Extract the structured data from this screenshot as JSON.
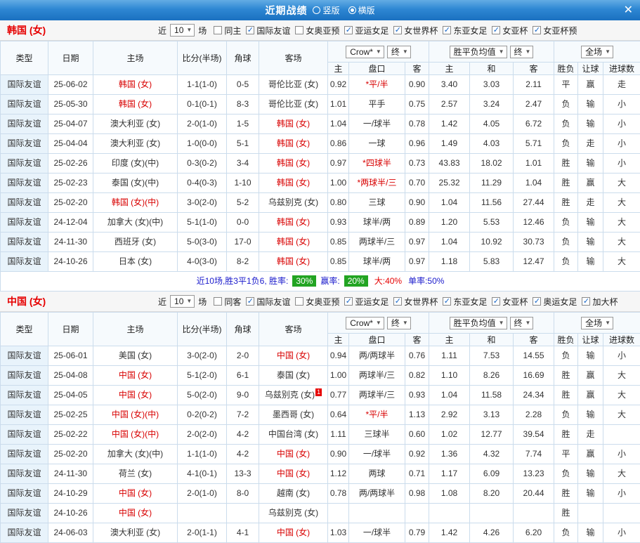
{
  "header": {
    "title": "近期战绩",
    "vertical_label": "竖版",
    "horizontal_label": "横版",
    "selected_layout": "横版",
    "close_glyph": "✕"
  },
  "colors": {
    "topbar_blue": "#1a70c0",
    "result_red": "#e60000",
    "result_green": "#009000",
    "result_blue": "#1a1acc",
    "team_red": "#d80000",
    "type_blue": "#0b50c0",
    "score_red": "#c02800",
    "badge_green": "#22a422",
    "grid_border": "#cbdcec"
  },
  "filter_labels": {
    "near": "近",
    "count": "10",
    "games": "场"
  },
  "table_headers": {
    "main": [
      "类型",
      "日期",
      "主场",
      "比分(半场)",
      "角球",
      "客场"
    ],
    "sub": [
      "主",
      "盘口",
      "客",
      "主",
      "和",
      "客",
      "胜负",
      "让球",
      "进球数"
    ],
    "odds_group_selects": [
      "Crow*",
      "终"
    ],
    "europe_group_selects": [
      "胜平负均值",
      "终"
    ],
    "result_group_selects": [
      "全场"
    ]
  },
  "sections": [
    {
      "title": "韩国 (女)",
      "filter_checkboxes": [
        {
          "label": "同主",
          "checked": false
        },
        {
          "label": "国际友谊",
          "checked": true
        },
        {
          "label": "女奥亚预",
          "checked": false
        },
        {
          "label": "亚运女足",
          "checked": true
        },
        {
          "label": "女世界杯",
          "checked": true
        },
        {
          "label": "东亚女足",
          "checked": true
        },
        {
          "label": "女亚杯",
          "checked": true
        },
        {
          "label": "女亚杯预",
          "checked": true
        }
      ],
      "rows": [
        {
          "type": "国际友谊",
          "date": "25-06-02",
          "home": "韩国 (女)",
          "home_red": true,
          "score": "1-1(1-0)",
          "corner": "0-5",
          "away": "哥伦比亚 (女)",
          "away_red": false,
          "h": "0.92",
          "hcap": "*平/半",
          "a": "0.90",
          "ew": "3.40",
          "ed": "3.03",
          "el": "2.11",
          "r1": "平",
          "r2": "赢",
          "r3": "走"
        },
        {
          "type": "国际友谊",
          "date": "25-05-30",
          "home": "韩国 (女)",
          "home_red": true,
          "score": "0-1(0-1)",
          "corner": "8-3",
          "away": "哥伦比亚 (女)",
          "away_red": false,
          "h": "1.01",
          "hcap": "平手",
          "a": "0.75",
          "ew": "2.57",
          "ed": "3.24",
          "el": "2.47",
          "r1": "负",
          "r2": "输",
          "r3": "小"
        },
        {
          "type": "国际友谊",
          "date": "25-04-07",
          "home": "澳大利亚 (女)",
          "home_red": false,
          "score": "2-0(1-0)",
          "corner": "1-5",
          "away": "韩国 (女)",
          "away_red": true,
          "h": "1.04",
          "hcap": "一/球半",
          "a": "0.78",
          "ew": "1.42",
          "ed": "4.05",
          "el": "6.72",
          "r1": "负",
          "r2": "输",
          "r3": "小"
        },
        {
          "type": "国际友谊",
          "date": "25-04-04",
          "home": "澳大利亚 (女)",
          "home_red": false,
          "score": "1-0(0-0)",
          "corner": "5-1",
          "away": "韩国 (女)",
          "away_red": true,
          "h": "0.86",
          "hcap": "一球",
          "a": "0.96",
          "ew": "1.49",
          "ed": "4.03",
          "el": "5.71",
          "r1": "负",
          "r2": "走",
          "r3": "小"
        },
        {
          "type": "国际友谊",
          "date": "25-02-26",
          "home": "印度 (女)(中)",
          "home_red": false,
          "score": "0-3(0-2)",
          "corner": "3-4",
          "away": "韩国 (女)",
          "away_red": true,
          "h": "0.97",
          "hcap": "*四球半",
          "a": "0.73",
          "ew": "43.83",
          "ed": "18.02",
          "el": "1.01",
          "r1": "胜",
          "r2": "输",
          "r3": "小"
        },
        {
          "type": "国际友谊",
          "date": "25-02-23",
          "home": "泰国 (女)(中)",
          "home_red": false,
          "score": "0-4(0-3)",
          "corner": "1-10",
          "away": "韩国 (女)",
          "away_red": true,
          "h": "1.00",
          "hcap": "*两球半/三",
          "a": "0.70",
          "ew": "25.32",
          "ed": "11.29",
          "el": "1.04",
          "r1": "胜",
          "r2": "赢",
          "r3": "大"
        },
        {
          "type": "国际友谊",
          "date": "25-02-20",
          "home": "韩国 (女)(中)",
          "home_red": true,
          "score": "3-0(2-0)",
          "corner": "5-2",
          "away": "乌兹别克 (女)",
          "away_red": false,
          "h": "0.80",
          "hcap": "三球",
          "a": "0.90",
          "ew": "1.04",
          "ed": "11.56",
          "el": "27.44",
          "r1": "胜",
          "r2": "走",
          "r3": "大"
        },
        {
          "type": "国际友谊",
          "date": "24-12-04",
          "home": "加拿大 (女)(中)",
          "home_red": false,
          "score": "5-1(1-0)",
          "corner": "0-0",
          "away": "韩国 (女)",
          "away_red": true,
          "h": "0.93",
          "hcap": "球半/两",
          "a": "0.89",
          "ew": "1.20",
          "ed": "5.53",
          "el": "12.46",
          "r1": "负",
          "r2": "输",
          "r3": "大"
        },
        {
          "type": "国际友谊",
          "date": "24-11-30",
          "home": "西班牙 (女)",
          "home_red": false,
          "score": "5-0(3-0)",
          "corner": "17-0",
          "away": "韩国 (女)",
          "away_red": true,
          "h": "0.85",
          "hcap": "两球半/三",
          "a": "0.97",
          "ew": "1.04",
          "ed": "10.92",
          "el": "30.73",
          "r1": "负",
          "r2": "输",
          "r3": "大"
        },
        {
          "type": "国际友谊",
          "date": "24-10-26",
          "home": "日本 (女)",
          "home_red": false,
          "score": "4-0(3-0)",
          "corner": "8-2",
          "away": "韩国 (女)",
          "away_red": true,
          "h": "0.85",
          "hcap": "球半/两",
          "a": "0.97",
          "ew": "1.18",
          "ed": "5.83",
          "el": "12.47",
          "r1": "负",
          "r2": "输",
          "r3": "大"
        }
      ],
      "summary": {
        "prefix": "近10场,胜3平1负6, 胜率:",
        "win_rate": "30%",
        "odds_label": "赢率:",
        "odds_rate": "20%",
        "big": "大:40%",
        "single": "单率:50%"
      }
    },
    {
      "title": "中国 (女)",
      "filter_checkboxes": [
        {
          "label": "同客",
          "checked": false
        },
        {
          "label": "国际友谊",
          "checked": true
        },
        {
          "label": "女奥亚预",
          "checked": false
        },
        {
          "label": "亚运女足",
          "checked": true
        },
        {
          "label": "女世界杯",
          "checked": true
        },
        {
          "label": "东亚女足",
          "checked": true
        },
        {
          "label": "女亚杯",
          "checked": true
        },
        {
          "label": "奥运女足",
          "checked": true
        },
        {
          "label": "加大杯",
          "checked": true
        }
      ],
      "rows": [
        {
          "type": "国际友谊",
          "date": "25-06-01",
          "home": "美国 (女)",
          "home_red": false,
          "score": "3-0(2-0)",
          "corner": "2-0",
          "away": "中国 (女)",
          "away_red": true,
          "h": "0.94",
          "hcap": "两/两球半",
          "a": "0.76",
          "ew": "1.11",
          "ed": "7.53",
          "el": "14.55",
          "r1": "负",
          "r2": "输",
          "r3": "小"
        },
        {
          "type": "国际友谊",
          "date": "25-04-08",
          "home": "中国 (女)",
          "home_red": true,
          "score": "5-1(2-0)",
          "corner": "6-1",
          "away": "泰国 (女)",
          "away_red": false,
          "h": "1.00",
          "hcap": "两球半/三",
          "a": "0.82",
          "ew": "1.10",
          "ed": "8.26",
          "el": "16.69",
          "r1": "胜",
          "r2": "赢",
          "r3": "大"
        },
        {
          "type": "国际友谊",
          "date": "25-04-05",
          "home": "中国 (女)",
          "home_red": true,
          "score": "5-0(2-0)",
          "corner": "9-0",
          "away": "乌兹别克 (女)",
          "away_red": false,
          "away_badge": "1",
          "h": "0.77",
          "hcap": "两球半/三",
          "a": "0.93",
          "ew": "1.04",
          "ed": "11.58",
          "el": "24.34",
          "r1": "胜",
          "r2": "赢",
          "r3": "大"
        },
        {
          "type": "国际友谊",
          "date": "25-02-25",
          "home": "中国 (女)(中)",
          "home_red": true,
          "score": "0-2(0-2)",
          "corner": "7-2",
          "away": "墨西哥 (女)",
          "away_red": false,
          "h": "0.64",
          "hcap": "*平/半",
          "a": "1.13",
          "ew": "2.92",
          "ed": "3.13",
          "el": "2.28",
          "r1": "负",
          "r2": "输",
          "r3": "大"
        },
        {
          "type": "国际友谊",
          "date": "25-02-22",
          "home": "中国 (女)(中)",
          "home_red": true,
          "score": "2-0(2-0)",
          "corner": "4-2",
          "away": "中国台湾 (女)",
          "away_red": false,
          "h": "1.11",
          "hcap": "三球半",
          "a": "0.60",
          "ew": "1.02",
          "ed": "12.77",
          "el": "39.54",
          "r1": "胜",
          "r2": "走",
          "r3": ""
        },
        {
          "type": "国际友谊",
          "date": "25-02-20",
          "home": "加拿大 (女)(中)",
          "home_red": false,
          "score": "1-1(1-0)",
          "corner": "4-2",
          "away": "中国 (女)",
          "away_red": true,
          "h": "0.90",
          "hcap": "一/球半",
          "a": "0.92",
          "ew": "1.36",
          "ed": "4.32",
          "el": "7.74",
          "r1": "平",
          "r2": "赢",
          "r3": "小"
        },
        {
          "type": "国际友谊",
          "date": "24-11-30",
          "home": "荷兰 (女)",
          "home_red": false,
          "score": "4-1(0-1)",
          "corner": "13-3",
          "away": "中国 (女)",
          "away_red": true,
          "h": "1.12",
          "hcap": "两球",
          "a": "0.71",
          "ew": "1.17",
          "ed": "6.09",
          "el": "13.23",
          "r1": "负",
          "r2": "输",
          "r3": "大"
        },
        {
          "type": "国际友谊",
          "date": "24-10-29",
          "home": "中国 (女)",
          "home_red": true,
          "score": "2-0(1-0)",
          "corner": "8-0",
          "away": "越南 (女)",
          "away_red": false,
          "h": "0.78",
          "hcap": "两/两球半",
          "a": "0.98",
          "ew": "1.08",
          "ed": "8.20",
          "el": "20.44",
          "r1": "胜",
          "r2": "输",
          "r3": "小"
        },
        {
          "type": "国际友谊",
          "date": "24-10-26",
          "home": "中国 (女)",
          "home_red": true,
          "score": "",
          "corner": "",
          "away": "乌兹别克 (女)",
          "away_red": false,
          "h": "",
          "hcap": "",
          "a": "",
          "ew": "",
          "ed": "",
          "el": "",
          "r1": "胜",
          "r2": "",
          "r3": ""
        },
        {
          "type": "国际友谊",
          "date": "24-06-03",
          "home": "澳大利亚 (女)",
          "home_red": false,
          "score": "2-0(1-1)",
          "corner": "4-1",
          "away": "中国 (女)",
          "away_red": true,
          "h": "1.03",
          "hcap": "一/球半",
          "a": "0.79",
          "ew": "1.42",
          "ed": "4.26",
          "el": "6.20",
          "r1": "负",
          "r2": "输",
          "r3": "小"
        }
      ]
    }
  ]
}
